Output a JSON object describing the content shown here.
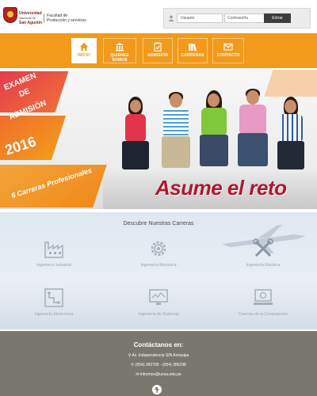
{
  "header": {
    "university_line1": "Universidad",
    "university_line2": "Nacional de",
    "university_line3": "San Agustín",
    "faculty_line1": "Facultad de",
    "faculty_line2": "Producción y servicios",
    "login": {
      "user_placeholder": "Usuario",
      "password_placeholder": "Contraseña",
      "submit_label": "Entrar"
    }
  },
  "nav": {
    "items": [
      {
        "label": "INICIO",
        "icon": "home-icon",
        "active": true
      },
      {
        "label": "QUIÉNES SOMOS",
        "icon": "institution-icon",
        "active": false
      },
      {
        "label": "ADMISIÓN",
        "icon": "clipboard-icon",
        "active": false
      },
      {
        "label": "CARRERAS",
        "icon": "books-icon",
        "active": false
      },
      {
        "label": "CONTACTO",
        "icon": "envelope-icon",
        "active": false
      }
    ]
  },
  "banner": {
    "line1": "EXAMEN",
    "line2": "DE",
    "line3": "ADMISIÓN",
    "year": "2016",
    "careers_count": "6 Carreras Profesionales",
    "slogan": "Asume el reto"
  },
  "careers": {
    "title": "Descubre Nuestras Carreras",
    "items": [
      {
        "label": "Ingeniería Industrial",
        "icon": "factory-icon"
      },
      {
        "label": "Ingeniería Mecánica",
        "icon": "gear-icon"
      },
      {
        "label": "Ingeniería Eléctrica",
        "icon": "tools-icon"
      },
      {
        "label": "Ingeniería Electrónica",
        "icon": "circuit-icon"
      },
      {
        "label": "Ingeniería de Sistemas",
        "icon": "monitor-icon"
      },
      {
        "label": "Ciencias de la Computación",
        "icon": "computer-icon"
      }
    ]
  },
  "footer": {
    "title": "Contáctanos en:",
    "address": "Av. Independencia S/N Arequipa",
    "phone": "(054) 282700 - (054) 285298",
    "email": "informes@unsa.edu.pe"
  },
  "colors": {
    "accent_orange": "#f29a1c",
    "slogan_red": "#b1172f",
    "footer_gray": "#7a786e"
  }
}
